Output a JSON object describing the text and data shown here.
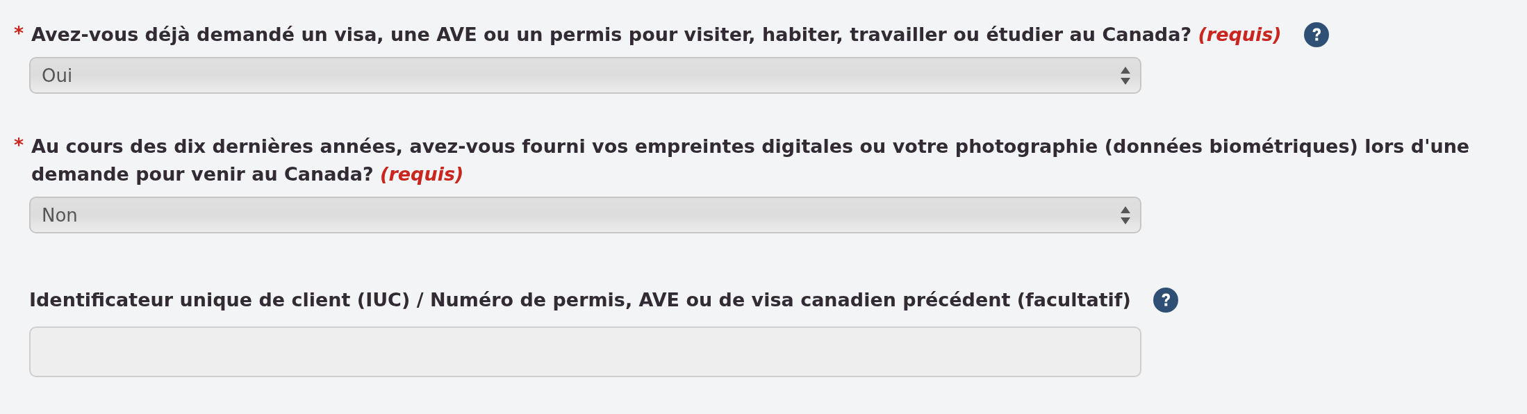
{
  "questions": [
    {
      "kind": "select",
      "marker": "*",
      "label": "Avez-vous déjà demandé un visa, une AVE ou un permis pour visiter, habiter, travailler ou étudier au Canada?",
      "note": "(requis)",
      "help": true,
      "value": "Oui"
    },
    {
      "kind": "select",
      "marker": "*",
      "label": "Au cours des dix dernières années, avez-vous fourni vos empreintes digitales ou votre photographie (données biométriques) lors d'une demande pour venir au Canada?",
      "note": "(requis)",
      "help": false,
      "value": "Non"
    },
    {
      "kind": "text",
      "label": "Identificateur unique de client (IUC) / Numéro de permis, AVE ou de visa canadien précédent (facultatif)",
      "help": true
    }
  ]
}
